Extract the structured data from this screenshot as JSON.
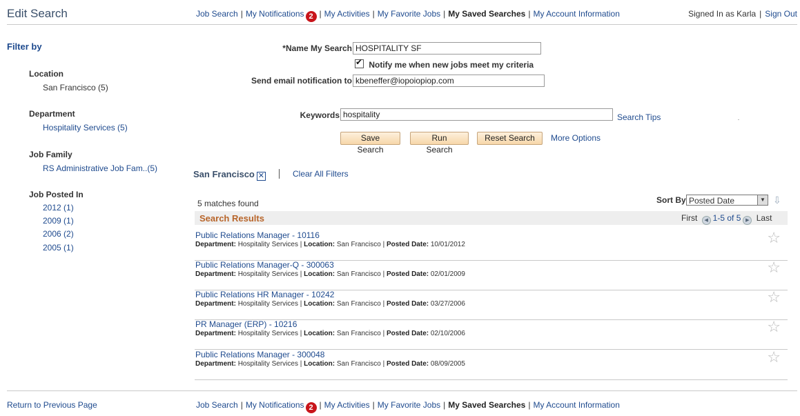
{
  "header": {
    "title": "Edit Search",
    "nav": [
      "Job Search",
      "My Notifications",
      "My Activities",
      "My Favorite Jobs",
      "My Saved Searches",
      "My Account Information"
    ],
    "notifications_count": "2",
    "signed_in": "Signed In as Karla",
    "sign_out": "Sign Out"
  },
  "sidebar": {
    "title": "Filter by",
    "sections": [
      {
        "heading": "Location",
        "items": [
          "San Francisco (5)"
        ]
      },
      {
        "heading": "Department",
        "items": [
          "Hospitality Services (5)"
        ]
      },
      {
        "heading": "Job Family",
        "items": [
          "RS Administrative Job Fam..(5)"
        ]
      },
      {
        "heading": "Job Posted In",
        "items": [
          "2012 (1)",
          "2009 (1)",
          "2006 (2)",
          "2005 (1)"
        ]
      }
    ]
  },
  "form": {
    "name_label": "*Name My Search",
    "name_value": "HOSPITALITY SF",
    "notify_label": "Notify me when new jobs meet my criteria",
    "email_label": "Send email notification to",
    "email_value": "kbeneffer@iopoiopiop.com",
    "keywords_label": "Keywords",
    "keywords_value": "hospitality",
    "search_tips": "Search Tips",
    "save_button": "Save Search",
    "run_button": "Run Search",
    "reset_button": "Reset Search",
    "more_options": "More Options"
  },
  "active_filters": {
    "chip": "San Francisco",
    "clear_all": "Clear All Filters"
  },
  "results": {
    "count_text": "5 matches found",
    "sort_label": "Sort By",
    "sort_value": "Posted Date",
    "header": "Search Results",
    "pager_first": "First",
    "pager_range": "1-5 of 5",
    "pager_last": "Last",
    "meta_labels": {
      "department": "Department:",
      "location": "Location:",
      "posted": "Posted Date:"
    },
    "rows": [
      {
        "title": "Public Relations Manager - 10116",
        "department": "Hospitality Services",
        "location": "San Francisco",
        "posted": "10/01/2012"
      },
      {
        "title": "Public Relations Manager-Q - 300063",
        "department": "Hospitality Services",
        "location": "San Francisco",
        "posted": "02/01/2009"
      },
      {
        "title": "Public Relations HR Manager - 10242",
        "department": "Hospitality Services",
        "location": "San Francisco",
        "posted": "03/27/2006"
      },
      {
        "title": "PR Manager (ERP) - 10216",
        "department": "Hospitality Services",
        "location": "San Francisco",
        "posted": "02/10/2006"
      },
      {
        "title": "Public Relations Manager - 300048",
        "department": "Hospitality Services",
        "location": "San Francisco",
        "posted": "08/09/2005"
      }
    ]
  },
  "footer": {
    "return_link": "Return to Previous Page"
  }
}
